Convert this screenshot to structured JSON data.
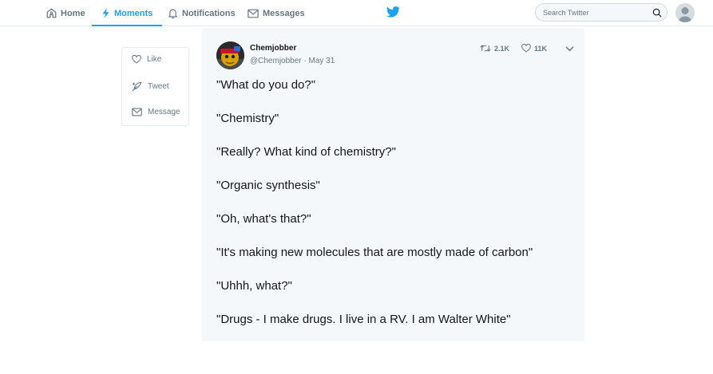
{
  "nav": {
    "items": [
      {
        "label": "Home",
        "icon": "home-icon",
        "active": false
      },
      {
        "label": "Moments",
        "icon": "lightning-icon",
        "active": true
      },
      {
        "label": "Notifications",
        "icon": "bell-icon",
        "active": false
      },
      {
        "label": "Messages",
        "icon": "envelope-icon",
        "active": false
      }
    ],
    "logo_icon": "twitter-bird-icon",
    "search": {
      "placeholder": "Search Twitter",
      "value": ""
    },
    "avatar_icon": "user-avatar"
  },
  "actions": [
    {
      "label": "Like",
      "icon": "heart-icon"
    },
    {
      "label": "Tweet",
      "icon": "feather-icon"
    },
    {
      "label": "Message",
      "icon": "envelope-icon"
    }
  ],
  "tweet": {
    "author_name": "Chemjobber",
    "author_meta": "@Chemjobber · May 31",
    "retweets": "2.1K",
    "likes": "11K",
    "lines": [
      "\"What do you do?\"",
      "\"Chemistry\"",
      "\"Really? What kind of chemistry?\"",
      "\"Organic synthesis\"",
      "\"Oh, what's that?\"",
      "\"It's making new molecules that are mostly made of carbon\"",
      "\"Uhhh, what?\"",
      "\"Drugs - I make drugs. I live in a RV. I am Walter White\""
    ]
  },
  "colors": {
    "brand": "#1da1f2",
    "text": "#14171a",
    "muted": "#657786",
    "panel_bg": "#f5f8fa",
    "border": "#e6ecf0"
  }
}
